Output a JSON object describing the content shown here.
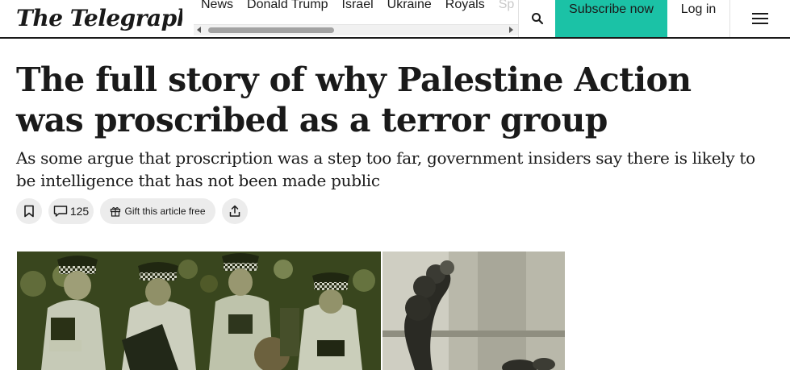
{
  "brand": {
    "name": "The Telegraph",
    "accent_color": "#1bc2a6"
  },
  "nav": {
    "items": [
      "News",
      "Donald Trump",
      "Israel",
      "Ukraine",
      "Royals",
      "Sp"
    ]
  },
  "header": {
    "search_icon": "search-icon",
    "subscribe_label": "Subscribe now",
    "login_label": "Log in",
    "menu_icon": "hamburger-menu-icon"
  },
  "article": {
    "headline": "The full story of why Palestine Action was proscribed as a terror group",
    "standfirst": "As some argue that proscription was a step too far, government insiders say there is likely to be intelligence that has not been made public",
    "actions": {
      "save_icon": "bookmark-icon",
      "comment_count": "125",
      "gift_label": "Gift this article free",
      "share_icon": "share-icon"
    },
    "images": {
      "left": "police-officers-photo",
      "right": "smoke-flare-photo"
    }
  }
}
